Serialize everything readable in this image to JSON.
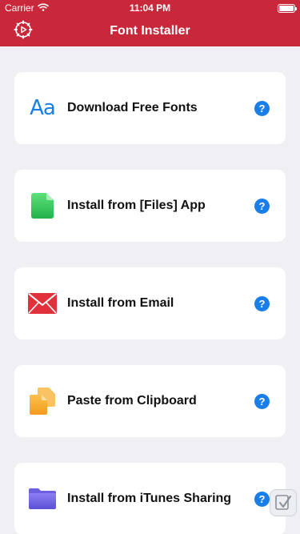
{
  "status_bar": {
    "carrier": "Carrier",
    "time": "11:04 PM"
  },
  "nav": {
    "title": "Font Installer",
    "settings_icon": "gear-icon"
  },
  "items": [
    {
      "label": "Download Free Fonts",
      "icon": "font-aa-icon",
      "help": "?"
    },
    {
      "label": "Install from [Files] App",
      "icon": "file-icon",
      "help": "?"
    },
    {
      "label": "Install from Email",
      "icon": "mail-icon",
      "help": "?"
    },
    {
      "label": "Paste from Clipboard",
      "icon": "clipboard-icon",
      "help": "?"
    },
    {
      "label": "Install from iTunes Sharing",
      "icon": "folder-icon",
      "help": "?"
    }
  ],
  "font_icon_text": "Aa",
  "colors": {
    "brand": "#c8283a",
    "background": "#efeff4",
    "help_blue": "#1a7ee8"
  }
}
